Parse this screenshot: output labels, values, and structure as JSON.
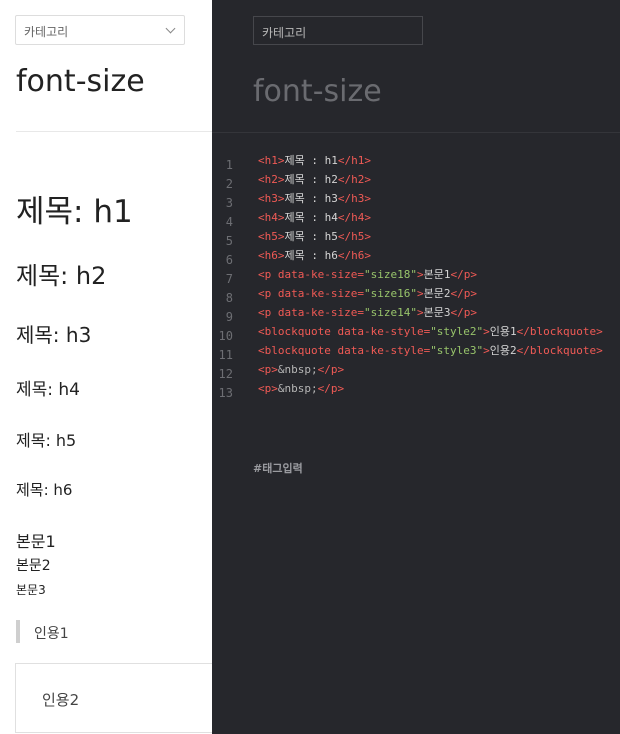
{
  "preview": {
    "category_placeholder": "카테고리",
    "title": "font-size",
    "h1": "제목: h1",
    "h2": "제목: h2",
    "h3": "제목: h3",
    "h4": "제목: h4",
    "h5": "제목: h5",
    "h6": "제목: h6",
    "body1": "본문1",
    "body2": "본문2",
    "body3": "본문3",
    "quote1": "인용1",
    "quote2": "인용2"
  },
  "editor": {
    "category_placeholder": "카테고리",
    "title": "font-size",
    "tag_input_placeholder": "#태그입력",
    "lines": [
      {
        "n": "1",
        "a": "<h1>",
        "t": "제목 : h1",
        "c": "</h1>"
      },
      {
        "n": "2",
        "a": "<h2>",
        "t": "제목 : h2",
        "c": "</h2>"
      },
      {
        "n": "3",
        "a": "<h3>",
        "t": "제목 : h3",
        "c": "</h3>"
      },
      {
        "n": "4",
        "a": "<h4>",
        "t": "제목 : h4",
        "c": "</h4>"
      },
      {
        "n": "5",
        "a": "<h5>",
        "t": "제목 : h5",
        "c": "</h5>"
      },
      {
        "n": "6",
        "a": "<h6>",
        "t": "제목 : h6",
        "c": "</h6>"
      },
      {
        "n": "7",
        "a": "<p data-ke-size=",
        "v": "\"size18\"",
        "b": ">",
        "t": "본문1",
        "c": "</p>"
      },
      {
        "n": "8",
        "a": "<p data-ke-size=",
        "v": "\"size16\"",
        "b": ">",
        "t": "본문2",
        "c": "</p>"
      },
      {
        "n": "9",
        "a": "<p data-ke-size=",
        "v": "\"size14\"",
        "b": ">",
        "t": "본문3",
        "c": "</p>"
      },
      {
        "n": "10",
        "a": "<blockquote data-ke-style=",
        "v": "\"style2\"",
        "b": ">",
        "t": "인용1",
        "c": "</blockquote>"
      },
      {
        "n": "11",
        "a": "<blockquote data-ke-style=",
        "v": "\"style3\"",
        "b": ">",
        "t": "인용2",
        "c": "</blockquote>"
      },
      {
        "n": "12",
        "a": "<p>",
        "e": "&nbsp;",
        "c": "</p>"
      },
      {
        "n": "13",
        "a": "<p>",
        "e": "&nbsp;",
        "c": "</p>"
      }
    ]
  }
}
